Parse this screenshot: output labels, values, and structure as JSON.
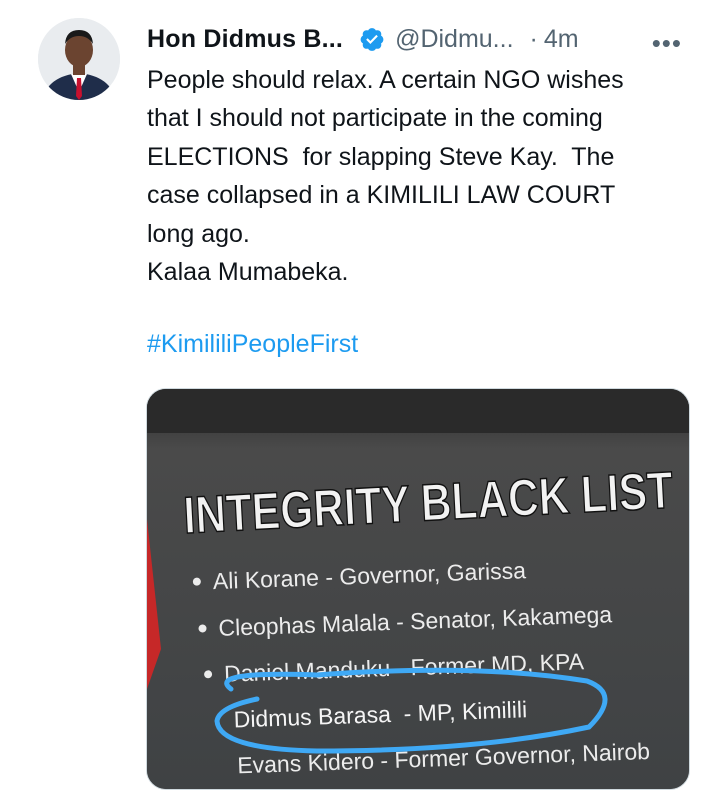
{
  "tweet": {
    "display_name": "Hon Didmus B...",
    "handle": "@Didmu...",
    "separator": "·",
    "time": "4m",
    "more_label": "•••",
    "text_lines": [
      "People should relax. A certain NGO wishes",
      "that I should not participate in the coming",
      "ELECTIONS  for slapping Steve Kay.  The",
      "case collapsed in a KIMILILI LAW COURT",
      "long ago.",
      "Kalaa Mumabeka."
    ],
    "hashtag": "#KimililiPeopleFirst"
  },
  "media": {
    "heading": "INTEGRITY BLACK LIST",
    "items": [
      "Ali Korane - Governor, Garissa",
      "Cleophas Malala - Senator, Kakamega",
      "Daniel Manduku - Former MD, KPA",
      "Didmus Barasa  - MP, Kimilili",
      "Evans Kidero - Former Governor, Nairob"
    ]
  },
  "colors": {
    "link": "#1d9bf0",
    "verified": "#1d9bf0",
    "secondary_text": "#536471",
    "circle_annotation": "#3fa9f5"
  }
}
